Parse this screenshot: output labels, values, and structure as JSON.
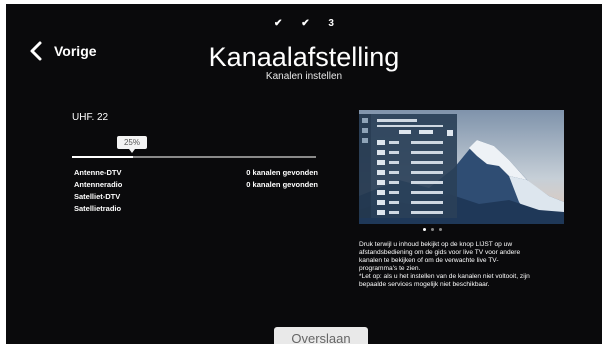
{
  "colors": {
    "background": "#0a0a0c",
    "text": "#ffffff",
    "skip_button_bg": "#e9e9e9",
    "progress_track": "#8a8a8a"
  },
  "steps": [
    {
      "label": "✔",
      "state": "done"
    },
    {
      "label": "✔",
      "state": "done"
    },
    {
      "label": "3",
      "state": "current"
    }
  ],
  "header": {
    "back_label": "Vorige",
    "back_icon": "chevron-left-icon",
    "title": "Kanaalafstelling",
    "subtitle": "Kanalen instellen"
  },
  "scan": {
    "frequency_label": "UHF. 22",
    "progress_label": "25%",
    "progress_fraction": 0.25,
    "rows": [
      {
        "name": "Antenne-DTV",
        "count": "0 kanalen gevonden"
      },
      {
        "name": "Antenneradio",
        "count": "0 kanalen gevonden"
      },
      {
        "name": "Satelliet-DTV",
        "count": ""
      },
      {
        "name": "Satellietradio",
        "count": ""
      }
    ]
  },
  "info": {
    "preview_image": "mountain-guide-preview",
    "pager_dots": 3,
    "pager_active": 0,
    "lines": [
      "Druk terwijl u inhoud bekijkt op de knop LIJST op uw",
      "afstandsbediening om de gids voor live TV voor andere",
      "kanalen te bekijken of om de verwachte live TV-",
      "programma's te zien.",
      "*Let op: als u het instellen van de kanalen niet voltooit, zijn",
      "bepaalde services mogelijk niet beschikbaar."
    ]
  },
  "footer": {
    "skip_label": "Overslaan"
  }
}
